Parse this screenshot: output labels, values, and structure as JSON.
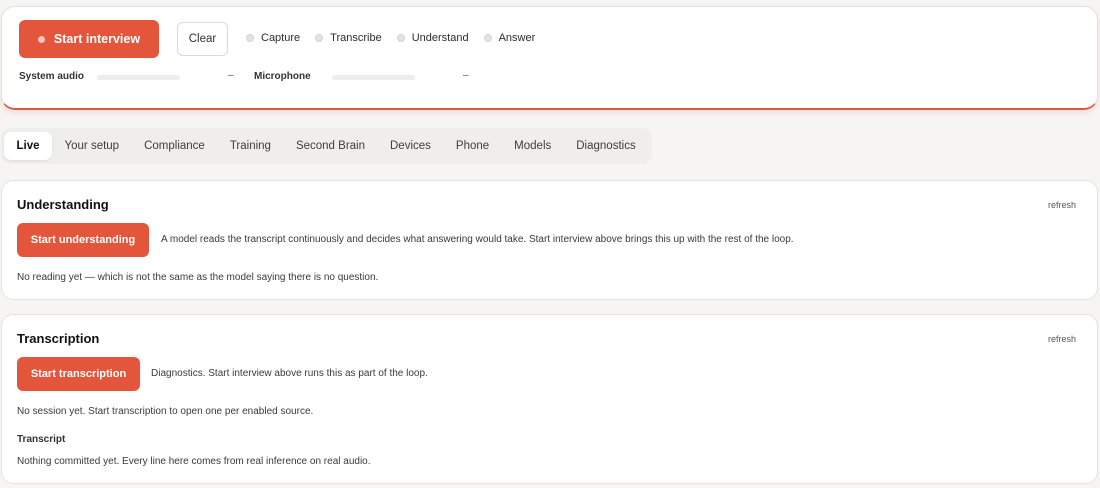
{
  "header": {
    "start_interview_label": "Start interview",
    "clear_label": "Clear",
    "steps": [
      "Capture",
      "Transcribe",
      "Understand",
      "Answer"
    ],
    "meters": {
      "system_audio": {
        "label": "System audio",
        "value": "–",
        "level": 0
      },
      "microphone": {
        "label": "Microphone",
        "value": "–",
        "level": 0
      }
    }
  },
  "tabs": [
    {
      "label": "Live",
      "active": true
    },
    {
      "label": "Your setup"
    },
    {
      "label": "Compliance"
    },
    {
      "label": "Training"
    },
    {
      "label": "Second Brain"
    },
    {
      "label": "Devices"
    },
    {
      "label": "Phone"
    },
    {
      "label": "Models"
    },
    {
      "label": "Diagnostics"
    }
  ],
  "understanding": {
    "title": "Understanding",
    "refresh_label": "refresh",
    "button_label": "Start understanding",
    "description": "A model reads the transcript continuously and decides what answering would take. Start interview above brings this up with the rest of the loop.",
    "status": "No reading yet — which is not the same as the model saying there is no question."
  },
  "transcription": {
    "title": "Transcription",
    "refresh_label": "refresh",
    "button_label": "Start transcription",
    "description": "Diagnostics. Start interview above runs this as part of the loop.",
    "status": "No session yet. Start transcription to open one per enabled source.",
    "transcript_heading": "Transcript",
    "transcript_empty": "Nothing committed yet. Every line here comes from real inference on real audio."
  },
  "colors": {
    "accent": "#e4563b",
    "background": "#f6f5f3"
  }
}
